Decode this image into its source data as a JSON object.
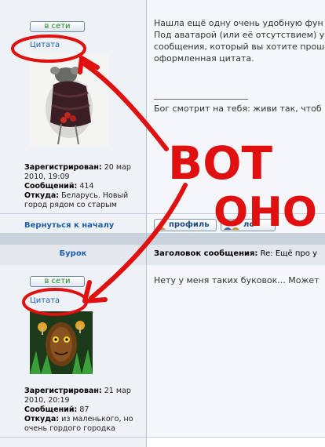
{
  "post1": {
    "online_badge": "в сети",
    "quote_label": "Цитата",
    "info": [
      {
        "label": "Зарегистрирован:",
        "value": "20 мар 2010, 19:09"
      },
      {
        "label": "Сообщений:",
        "value": "414"
      },
      {
        "label": "Откуда:",
        "value": "Беларусь. Новый город рядом со старым"
      }
    ],
    "body_lines": [
      "Нашла ещё одну очень удобную фун",
      "Под аватарой (или её отсутствием) у",
      "сообщения, который вы хотите прош",
      "оформленная цитата."
    ],
    "signature": "Бог смотрит на тебя: живи так, чтоб",
    "back_to_top": "Вернуться к началу",
    "profile_button": "профиль",
    "pm_button": "лс"
  },
  "post2": {
    "author": "Бурок",
    "subject_label": "Заголовок сообщения:",
    "subject_value": "Re: Ещё про у",
    "online_badge": "в сети",
    "quote_label": "Цитата",
    "info": [
      {
        "label": "Зарегистрирован:",
        "value": "21 мар 2010, 20:19"
      },
      {
        "label": "Сообщений:",
        "value": "87"
      },
      {
        "label": "Откуда:",
        "value": "из маленького, но очень гордого городка"
      }
    ],
    "body_line": "Нету у меня таких буковок... Может"
  },
  "annotation": {
    "text_line1": "ВОТ",
    "text_line2": "ОНО",
    "color": "#e01010"
  }
}
